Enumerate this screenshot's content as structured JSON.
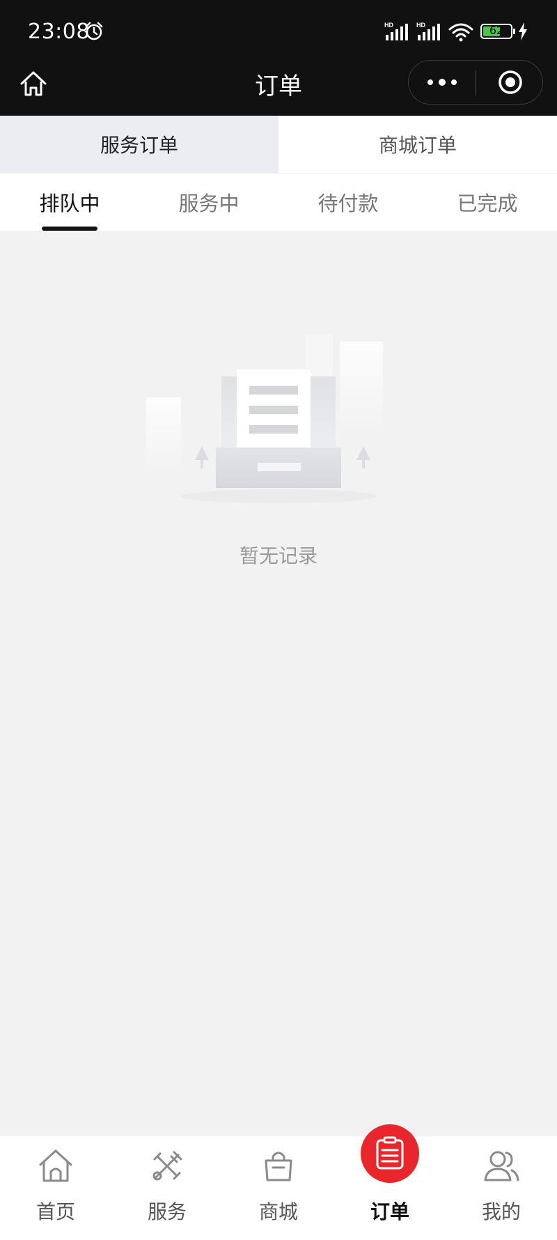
{
  "status_bar": {
    "time": "23:08",
    "signal_1_label": "HD",
    "signal_2_label": "HD",
    "battery_level": "62",
    "icons": [
      "alarm-icon",
      "signal-icon",
      "signal-icon",
      "wifi-icon",
      "battery-icon",
      "charging-icon"
    ]
  },
  "nav": {
    "title": "订单",
    "home_icon": "home-outline-icon",
    "more_icon": "more-dots-icon",
    "close_icon": "target-circle-icon"
  },
  "order_type_tabs": [
    {
      "label": "服务订单",
      "active": true
    },
    {
      "label": "商城订单",
      "active": false
    }
  ],
  "status_tabs": [
    {
      "label": "排队中",
      "active": true
    },
    {
      "label": "服务中",
      "active": false
    },
    {
      "label": "待付款",
      "active": false
    },
    {
      "label": "已完成",
      "active": false
    }
  ],
  "empty_state": {
    "illustration": "empty-document-tray-icon",
    "text": "暂无记录"
  },
  "tabbar": {
    "items": [
      {
        "label": "首页",
        "icon": "home-icon",
        "active": false
      },
      {
        "label": "服务",
        "icon": "tools-icon",
        "active": false
      },
      {
        "label": "商城",
        "icon": "shopping-bag-icon",
        "active": false
      },
      {
        "label": "订单",
        "icon": "order-list-icon",
        "active": true
      },
      {
        "label": "我的",
        "icon": "user-group-icon",
        "active": false
      }
    ]
  },
  "colors": {
    "topbar_bg": "#111111",
    "page_bg": "#f2f2f3",
    "accent_red": "#e8262c",
    "battery_green": "#4cc34a",
    "active_type_tab_bg": "#ebedf3"
  }
}
